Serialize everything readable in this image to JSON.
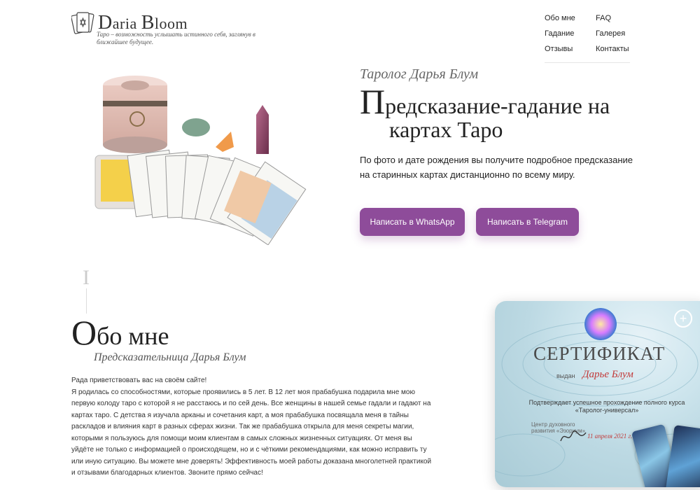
{
  "header": {
    "logo_name_first": "D",
    "logo_name_rest": "aria ",
    "logo_name_first2": "B",
    "logo_name_rest2": "loom",
    "tagline": "Таро – возможность услышать истинного себя, заглянув в ближайшее будущее.",
    "logo_icon": "tarot-star-logo-icon"
  },
  "nav": {
    "items": [
      "Обо мне",
      "FAQ",
      "Гадание",
      "Галерея",
      "Отзывы",
      "Контакты"
    ]
  },
  "hero": {
    "subtitle": "Таролог Дарья Блум",
    "title_cap": "П",
    "title_line1": "редсказание-гадание на",
    "title_line2": "картах Таро",
    "description": "По фото и дате рождения вы получите подробное предсказание на старинных картах дистанционно по всему миру.",
    "btn_whatsapp": "Написать в WhatsApp",
    "btn_telegram": "Написать в Telegram",
    "accent": "#8e4c9a"
  },
  "about": {
    "number": "I",
    "title_cap": "О",
    "title_rest": "бо мне",
    "subtitle": "Предсказательница Дарья Блум",
    "paragraphs": [
      "Рада приветствовать вас на своём сайте!",
      "Я родилась со способностями, которые проявились в 5 лет. В 12 лет моя прабабушка подарила мне мою первую колоду таро с которой я не расстаюсь и по сей день. Все женщины в нашей семье гадали и гадают на картах таро. С детства я изучала арканы и сочетания карт, а моя прабабушка посвящала меня в тайны раскладов и влияния карт в разных сферах жизни. Так же прабабушка открыла для меня секреты магии, которыми я пользуюсь для помощи моим клиентам в самых сложных жизненных ситуациях. От меня вы уйдёте не только с информацией о происходящем, но и с чёткими рекомендациями, как можно исправить ту или иную ситуацию. Вы можете мне доверять! Эффективность моей работы доказана многолетней практикой и отзывами благодарных клиентов. Звоните прямо сейчас!"
    ]
  },
  "certificate": {
    "title": "СЕРТИФИКАТ",
    "issued": "выдан",
    "name": "Дарье Блум",
    "description": "Подтверждает успешное прохождение полного курса «Таролог-универсал»",
    "center": "Центр духовного развития «Эзориум»",
    "date": "11 апреля 2021 г.",
    "zoom_icon": "plus-circle-icon"
  }
}
